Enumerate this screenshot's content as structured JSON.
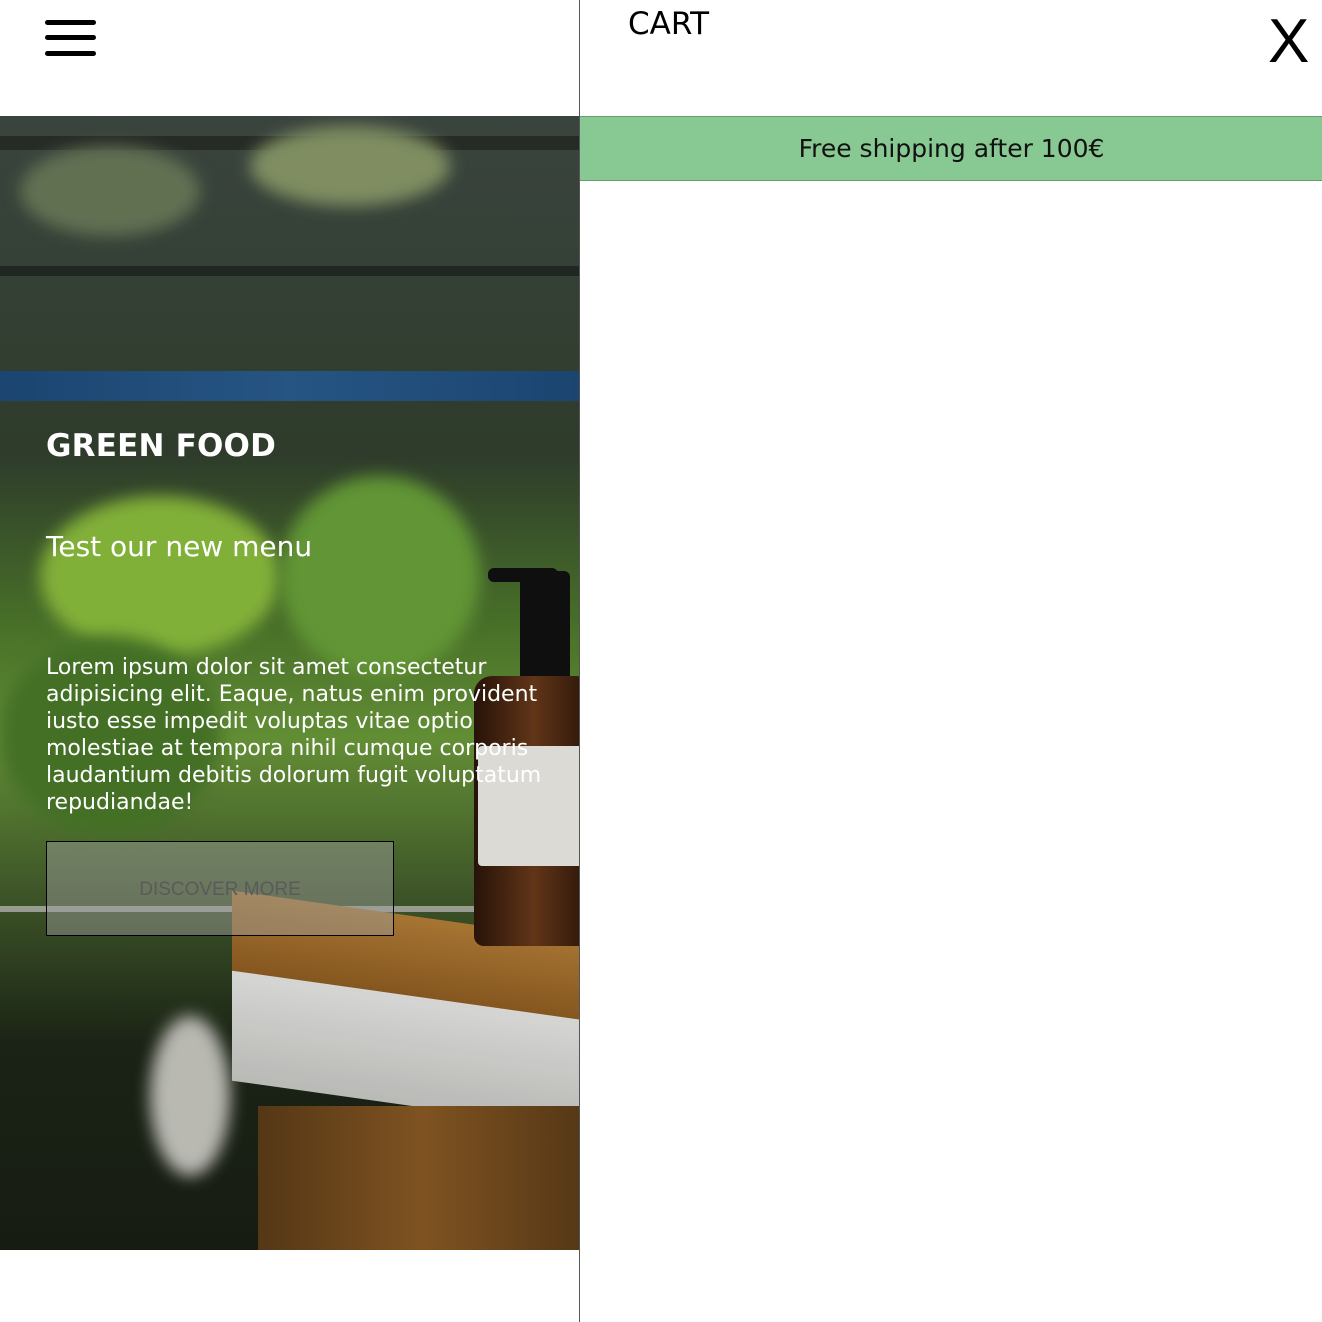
{
  "menu": {
    "icon": "hamburger-menu-icon"
  },
  "hero": {
    "title": "GREEN FOOD",
    "subtitle": "Test our new menu",
    "body": "Lorem ipsum dolor sit amet consectetur adipisicing elit. Eaque, natus enim provident iusto esse impedit voluptas vitae optio molestiae at tempora nihil cumque corporis laudantium debitis dolorum fugit voluptatum repudiandae!",
    "cta_label": "DISCOVER MORE",
    "image": "greenhouse-plants-lotion-bottle-photo"
  },
  "cart": {
    "title": "CART",
    "close_label": "X",
    "shipping_banner": "Free shipping after 100€",
    "banner_color": "#88c893"
  }
}
